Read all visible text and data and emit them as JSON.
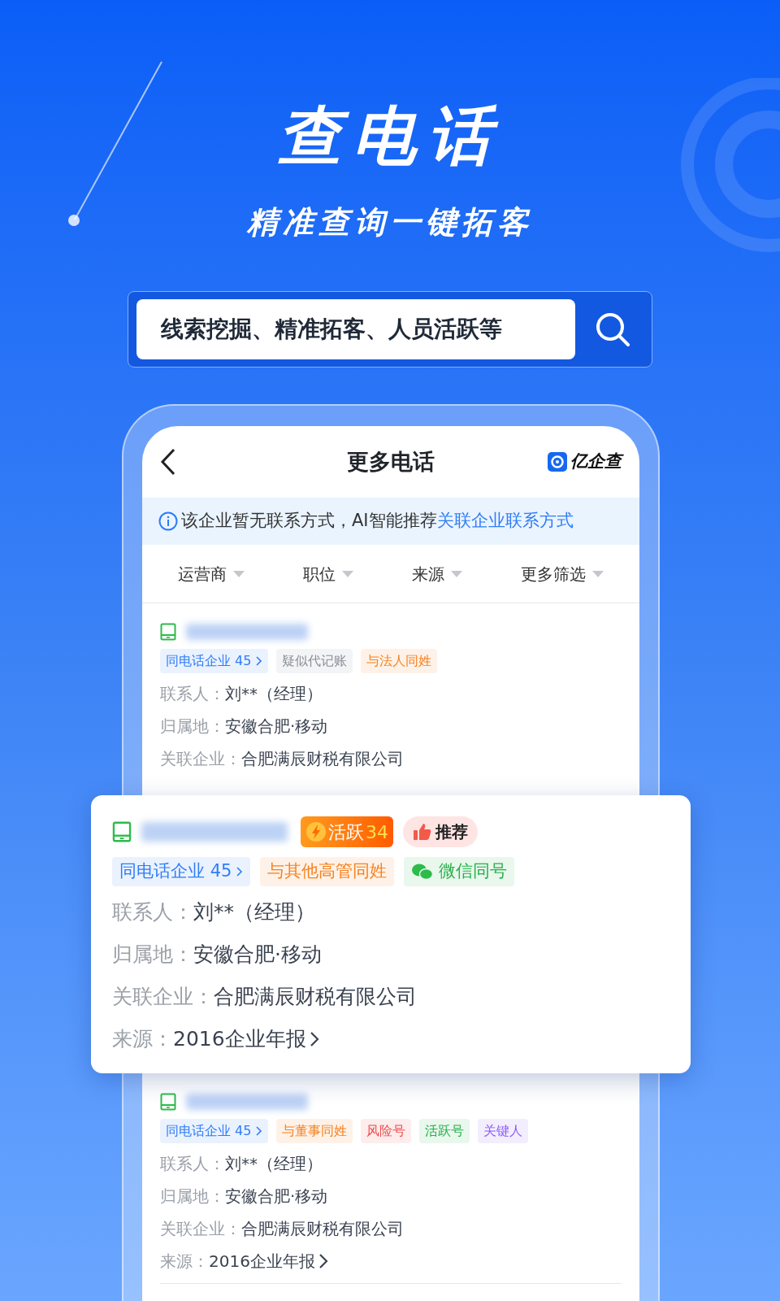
{
  "hero": {
    "title": "查电话",
    "subtitle": "精准查询一键拓客"
  },
  "search": {
    "value": "线索挖掘、精准拓客、人员活跃等"
  },
  "app": {
    "title": "更多电话",
    "brand": "亿企查",
    "notice": {
      "text": "该企业暂无联系方式，AI智能推荐",
      "link": "关联企业联系方式"
    },
    "filters": [
      "运营商",
      "职位",
      "来源",
      "更多筛选"
    ],
    "records": [
      {
        "elevated": false,
        "tags": [
          {
            "label": "同电话企业 45",
            "kind": "link",
            "color": "#2f7cf6"
          },
          {
            "label": "疑似代记账",
            "kind": "plain",
            "color": "#8a8f99"
          },
          {
            "label": "与法人同姓",
            "kind": "plain",
            "color": "#f7811e"
          }
        ],
        "fields": [
          {
            "label": "联系人：",
            "value": "刘**（经理）",
            "kind": "text"
          },
          {
            "label": "归属地：",
            "value": "安徽合肥·移动",
            "kind": "text"
          },
          {
            "label": "关联企业：",
            "value": "合肥满辰财税有限公司",
            "kind": "text"
          }
        ]
      },
      {
        "elevated": true,
        "badges": [
          {
            "kind": "activity",
            "label": "活跃",
            "value": "34"
          },
          {
            "kind": "recommend",
            "label": "推荐"
          }
        ],
        "tags": [
          {
            "label": "同电话企业 45",
            "kind": "link",
            "color": "#2f7cf6"
          },
          {
            "label": "与其他高管同姓",
            "kind": "plain",
            "color": "#f7811e"
          },
          {
            "label": "微信同号",
            "kind": "wechat",
            "color": "#27b04a"
          }
        ],
        "fields": [
          {
            "label": "联系人：",
            "value": "刘**（经理）",
            "kind": "text"
          },
          {
            "label": "归属地：",
            "value": "安徽合肥·移动",
            "kind": "text"
          },
          {
            "label": "关联企业：",
            "value": "合肥满辰财税有限公司",
            "kind": "text"
          },
          {
            "label": "来源：",
            "value": "2016企业年报",
            "kind": "link"
          }
        ]
      },
      {
        "elevated": false,
        "tags": [
          {
            "label": "同电话企业 45",
            "kind": "link",
            "color": "#2f7cf6"
          },
          {
            "label": "与董事同姓",
            "kind": "plain",
            "color": "#f7811e"
          },
          {
            "label": "风险号",
            "kind": "plain",
            "color": "#f04a4a"
          },
          {
            "label": "活跃号",
            "kind": "plain",
            "color": "#27b04a"
          },
          {
            "label": "关键人",
            "kind": "plain",
            "color": "#8b5cf6"
          }
        ],
        "fields": [
          {
            "label": "联系人：",
            "value": "刘**（经理）",
            "kind": "text"
          },
          {
            "label": "归属地：",
            "value": "安徽合肥·移动",
            "kind": "text"
          },
          {
            "label": "关联企业：",
            "value": "合肥满辰财税有限公司",
            "kind": "text"
          },
          {
            "label": "来源：",
            "value": "2016企业年报",
            "kind": "link"
          }
        ]
      }
    ]
  }
}
